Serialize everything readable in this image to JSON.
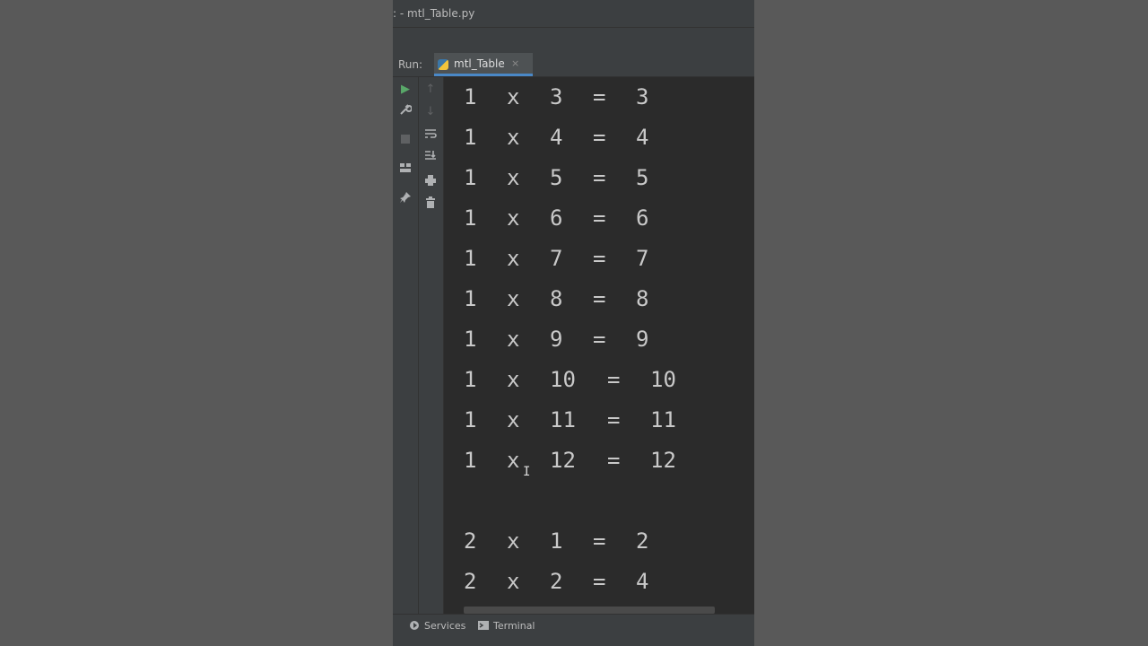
{
  "window": {
    "title": ": - mtl_Table.py"
  },
  "run_panel": {
    "label": "Run:",
    "tab": {
      "label": "mtl_Table",
      "close": "×"
    }
  },
  "left_gutter_icons": [
    "run-icon",
    "wrench-icon",
    "stop-icon",
    "layout-icon",
    "pin-icon"
  ],
  "right_gutter_icons": [
    "arrow-up-icon",
    "arrow-down-icon",
    "soft-wrap-icon",
    "scroll-to-end-icon",
    "print-icon",
    "trash-icon"
  ],
  "console": {
    "lines": [
      [
        "1",
        "x",
        "3",
        "=",
        "3"
      ],
      [
        "1",
        "x",
        "4",
        "=",
        "4"
      ],
      [
        "1",
        "x",
        "5",
        "=",
        "5"
      ],
      [
        "1",
        "x",
        "6",
        "=",
        "6"
      ],
      [
        "1",
        "x",
        "7",
        "=",
        "7"
      ],
      [
        "1",
        "x",
        "8",
        "=",
        "8"
      ],
      [
        "1",
        "x",
        "9",
        "=",
        "9"
      ],
      [
        "1",
        "x",
        "10",
        "=",
        "10"
      ],
      [
        "1",
        "x",
        "11",
        "=",
        "11"
      ],
      [
        "1",
        "x",
        "12",
        "=",
        "12"
      ],
      [
        "",
        "",
        "",
        "",
        ""
      ],
      [
        "2",
        "x",
        "1",
        "=",
        "2"
      ],
      [
        "2",
        "x",
        "2",
        "=",
        "4"
      ]
    ]
  },
  "bottom_bar": {
    "services": "Services",
    "terminal": "Terminal"
  },
  "colors": {
    "background": "#2b2b2b",
    "panel": "#3c3f41",
    "accent": "#4a88c7",
    "run_green": "#59a869"
  }
}
